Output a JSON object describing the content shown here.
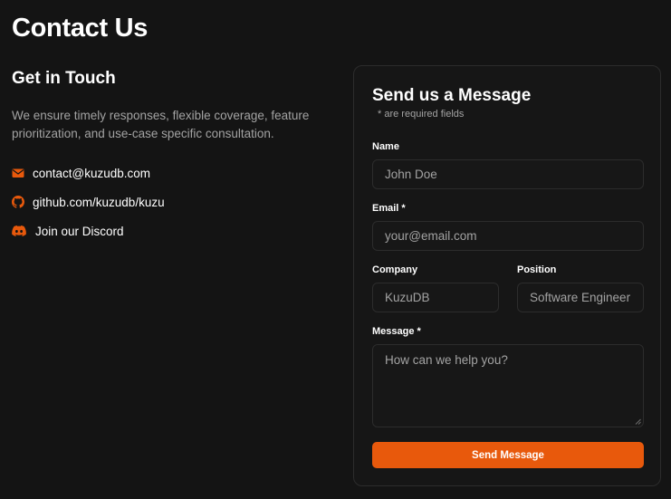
{
  "page": {
    "title": "Contact Us"
  },
  "get_in_touch": {
    "heading": "Get in Touch",
    "description": "We ensure timely responses, flexible coverage, feature prioritization, and use-case specific consultation.",
    "contacts": [
      {
        "icon": "envelope-icon",
        "label": "contact@kuzudb.com"
      },
      {
        "icon": "github-icon",
        "label": "github.com/kuzudb/kuzu"
      },
      {
        "icon": "discord-icon",
        "label": "Join our Discord"
      }
    ]
  },
  "form": {
    "title": "Send us a Message",
    "required_note": "* are required fields",
    "name": {
      "label": "Name",
      "placeholder": "John Doe"
    },
    "email": {
      "label": "Email *",
      "placeholder": "your@email.com"
    },
    "company": {
      "label": "Company",
      "placeholder": "KuzuDB"
    },
    "position": {
      "label": "Position",
      "placeholder": "Software Engineer"
    },
    "message": {
      "label": "Message *",
      "placeholder": "How can we help you?"
    },
    "submit_label": "Send Message"
  },
  "colors": {
    "background": "#141414",
    "accent": "#e8590c",
    "muted_text": "#a3a3a3",
    "border": "#2c2c2c"
  }
}
